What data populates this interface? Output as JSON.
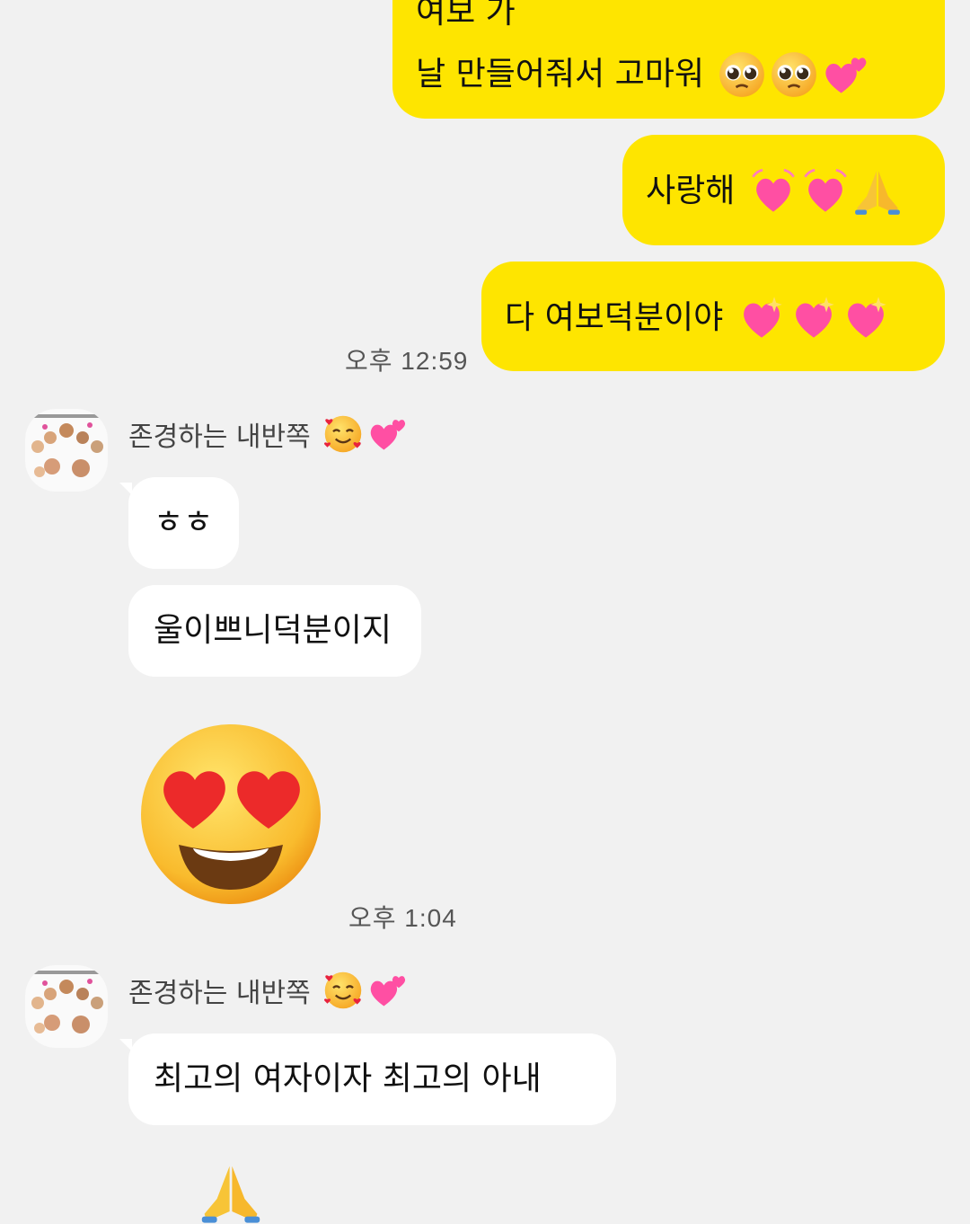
{
  "outgoing": [
    {
      "text": "여보 가",
      "emojis": []
    },
    {
      "text": "날 만들어줘서  고마워",
      "emojis": [
        "pleading-face-icon",
        "pleading-face-icon",
        "two-hearts-icon"
      ]
    },
    {
      "text": "사랑해",
      "emojis": [
        "growing-heart-icon",
        "growing-heart-icon",
        "folded-hands-icon"
      ]
    },
    {
      "text": "다 여보덕분이야",
      "emojis": [
        "sparkling-heart-icon",
        "sparkling-heart-icon",
        "sparkling-heart-icon"
      ]
    }
  ],
  "times": [
    "오후 12:59",
    "오후 1:04"
  ],
  "sender": {
    "name": "존경하는 내반쪽",
    "name_emojis": [
      "smiling-face-with-hearts-icon",
      "two-hearts-icon"
    ]
  },
  "incoming_group_1": [
    {
      "text": "ㅎㅎ"
    },
    {
      "text": "울이쁘니덕분이지"
    }
  ],
  "incoming_sticker": {
    "icon": "heart-eyes-face-icon"
  },
  "incoming_group_2": [
    {
      "text": "최고의 여자이자 최고의 아내"
    }
  ],
  "incoming_partial": {
    "icon": "folded-hands-icon"
  },
  "colors": {
    "outgoing_bubble": "#fee500",
    "incoming_bubble": "#ffffff",
    "background": "#f1f1f1"
  }
}
